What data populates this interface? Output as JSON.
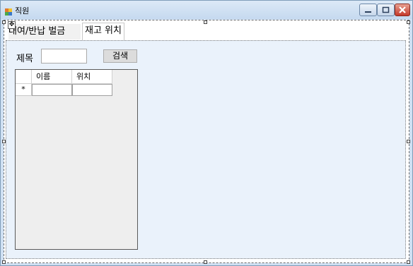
{
  "window": {
    "title": "직원",
    "icon": "app-icon"
  },
  "tabs": [
    {
      "label": "대여/반납 벌금",
      "active": false
    },
    {
      "label": "재고 위치",
      "active": true
    }
  ],
  "search": {
    "label": "제목",
    "value": "",
    "button_label": "검색"
  },
  "grid": {
    "columns": [
      "이름",
      "위치"
    ],
    "new_row_marker": "*"
  },
  "colors": {
    "tab_page_bg": "#eaf2fb",
    "close_button": "#c4382a"
  }
}
